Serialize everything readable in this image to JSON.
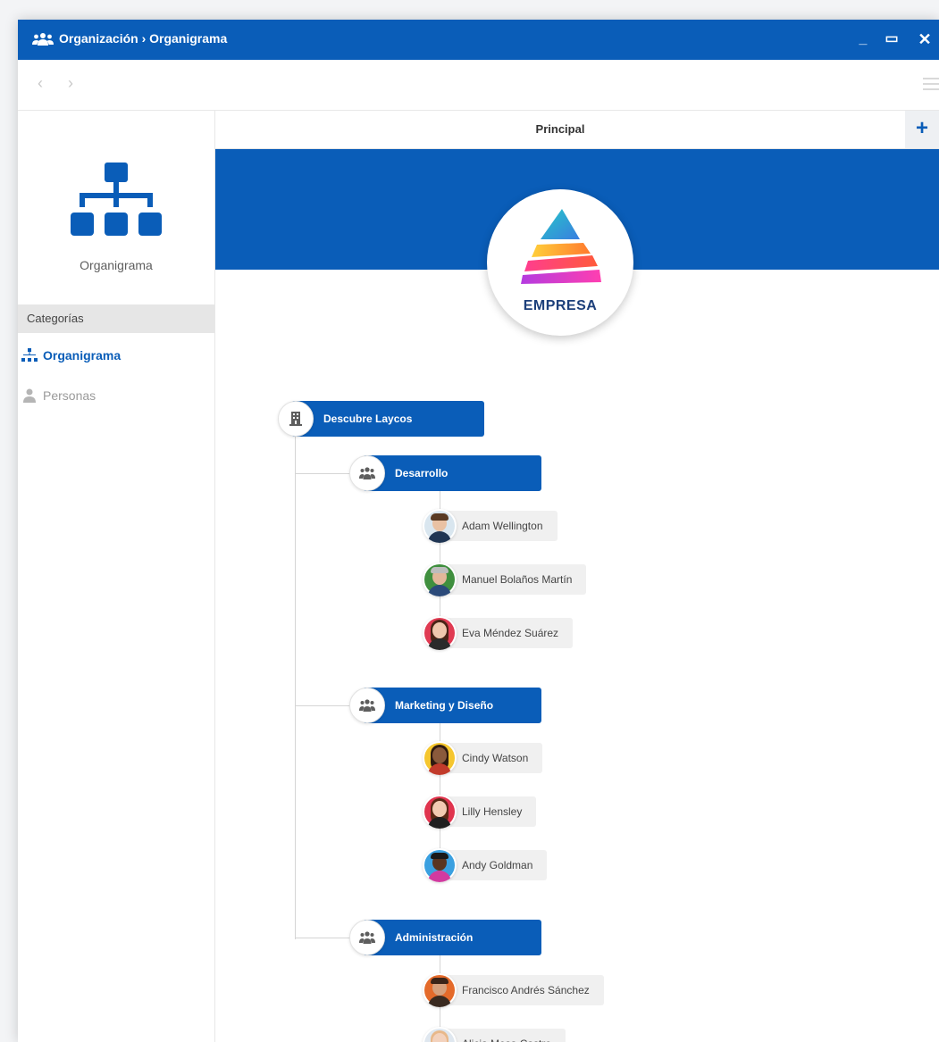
{
  "window": {
    "title": "Organización › Organigrama",
    "title_icon": "users-icon",
    "minimize_glyph": "_",
    "maximize_glyph": "▭",
    "close_glyph": "✕"
  },
  "toolbar": {
    "back_glyph": "‹",
    "forward_glyph": "›"
  },
  "sidebar": {
    "hero_label": "Organigrama",
    "categories_header": "Categorías",
    "items": [
      {
        "label": "Organigrama",
        "icon": "org-chart-icon",
        "active": true
      },
      {
        "label": "Personas",
        "icon": "person-icon",
        "active": false
      }
    ]
  },
  "tabs": {
    "principal": "Principal",
    "add_glyph": "+"
  },
  "company": {
    "logo_text": "EMPRESA"
  },
  "org": {
    "root": "Descubre Laycos",
    "departments": [
      {
        "name": "Desarrollo",
        "members": [
          "Adam Wellington",
          "Manuel Bolaños Martín",
          "Eva Méndez Suárez"
        ]
      },
      {
        "name": "Marketing y Diseño",
        "members": [
          "Cindy Watson",
          "Lilly Hensley",
          "Andy Goldman"
        ]
      },
      {
        "name": "Administración",
        "members": [
          "Francisco Andrés Sánchez",
          "Alicia Mesa Castro"
        ]
      }
    ]
  },
  "colors": {
    "brand_blue": "#0a5db8"
  }
}
